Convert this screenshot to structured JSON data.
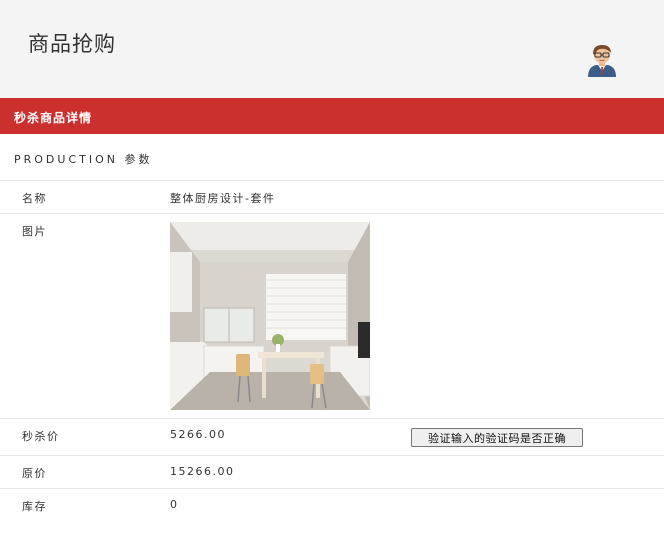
{
  "header": {
    "title": "商品抢购",
    "avatar_icon": "user-avatar-icon"
  },
  "banner": {
    "title": "秒杀商品详情",
    "color": "#cb2f2e"
  },
  "section": {
    "title": "PRODUCTION 参数"
  },
  "rows": {
    "name": {
      "label": "名称",
      "value": "整体厨房设计-套件"
    },
    "image": {
      "label": "图片"
    },
    "seckill_price": {
      "label": "秒杀价",
      "value": "5266.00"
    },
    "original_price": {
      "label": "原价",
      "value": "15266.00"
    },
    "stock": {
      "label": "库存",
      "value": "0"
    }
  },
  "buttons": {
    "verify_label": "验证输入的验证码是否正确"
  }
}
